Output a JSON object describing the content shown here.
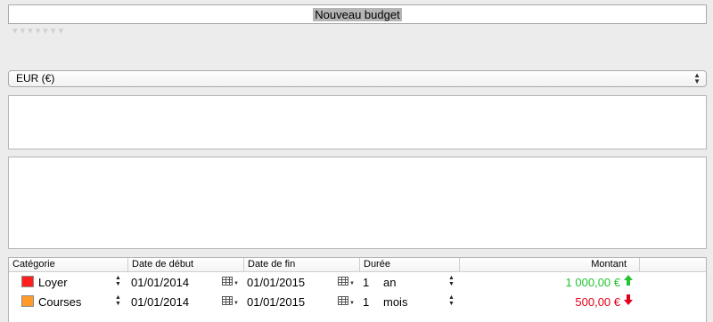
{
  "colors": {
    "positive": "#22c431",
    "negative": "#e3001b",
    "loyer_swatch": "#ff1f1f",
    "courses_swatch": "#ff9a2b"
  },
  "header": {
    "title_value": "Nouveau budget"
  },
  "currency": {
    "selected": "EUR (€)"
  },
  "table": {
    "columns": {
      "categorie": "Catégorie",
      "date_debut": "Date de début",
      "date_fin": "Date de fin",
      "duree": "Durée",
      "montant": "Montant"
    },
    "rows": [
      {
        "category": "Loyer",
        "swatch_color": "#ff1f1f",
        "start_date": "01/01/2014",
        "end_date": "01/01/2015",
        "duration_value": "1",
        "duration_unit": "an",
        "amount": "1 000,00 €",
        "direction": "up-arrow-icon"
      },
      {
        "category": "Courses",
        "swatch_color": "#ff9a2b",
        "start_date": "01/01/2014",
        "end_date": "01/01/2015",
        "duration_value": "1",
        "duration_unit": "mois",
        "amount": "500,00 €",
        "direction": "down-arrow-icon"
      }
    ]
  }
}
